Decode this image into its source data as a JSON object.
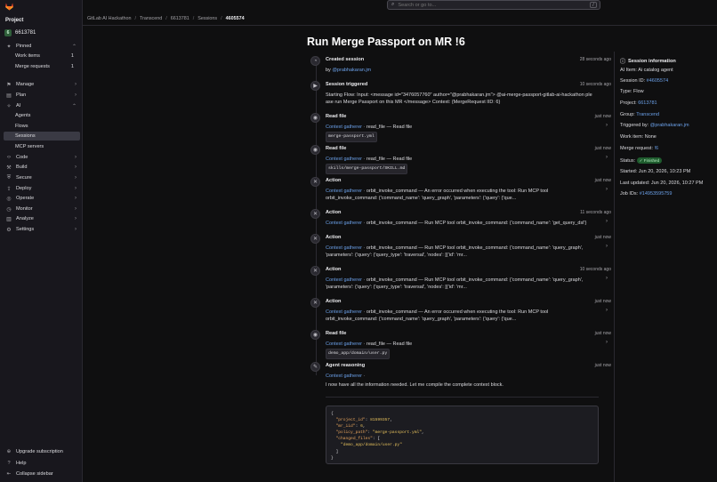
{
  "app": {
    "logo_icon": "gitlab-tanuki-icon"
  },
  "sidebar": {
    "context_label": "Project",
    "project": {
      "badge": "6",
      "name": "6613781"
    },
    "items": [
      {
        "label": "Pinned",
        "icon": "pin-icon",
        "chev": "⌃"
      },
      {
        "label": "Work items",
        "count": "1",
        "sub": true
      },
      {
        "label": "Merge requests",
        "count": "1",
        "sub": true
      },
      {
        "label": "Manage",
        "icon": "manage-icon",
        "chev": "›"
      },
      {
        "label": "Plan",
        "icon": "plan-icon",
        "chev": "›"
      },
      {
        "label": "AI",
        "icon": "ai-icon",
        "chev": "⌃"
      },
      {
        "label": "Agents",
        "sub": true
      },
      {
        "label": "Flows",
        "sub": true
      },
      {
        "label": "Sessions",
        "sub": true,
        "active": true
      },
      {
        "label": "MCP servers",
        "sub": true
      },
      {
        "label": "Code",
        "icon": "code-icon",
        "chev": "›"
      },
      {
        "label": "Build",
        "icon": "build-icon",
        "chev": "›"
      },
      {
        "label": "Secure",
        "icon": "shield-icon",
        "chev": "›"
      },
      {
        "label": "Deploy",
        "icon": "deploy-icon",
        "chev": "›"
      },
      {
        "label": "Operate",
        "icon": "operate-icon",
        "chev": "›"
      },
      {
        "label": "Monitor",
        "icon": "monitor-icon",
        "chev": "›"
      },
      {
        "label": "Analyze",
        "icon": "analyze-icon",
        "chev": "›"
      },
      {
        "label": "Settings",
        "icon": "gear-icon",
        "chev": "›"
      }
    ],
    "bottom": [
      {
        "label": "Upgrade subscription",
        "icon": "upgrade-icon"
      },
      {
        "label": "Help",
        "icon": "help-icon"
      },
      {
        "label": "Collapse sidebar",
        "icon": "collapse-icon"
      }
    ]
  },
  "search": {
    "placeholder": "Search or go to...",
    "shortcut": "/"
  },
  "breadcrumb": [
    "GitLab AI Hackathon",
    "Transcend",
    "6613781",
    "Sessions",
    "4605574"
  ],
  "page": {
    "title": "Run Merge Passport on MR !6"
  },
  "timeline": [
    {
      "title": "Created session",
      "time": "28 seconds ago",
      "icon": "session-icon",
      "line1_pre": "by ",
      "line1_link": "@prabhakaran.jm"
    },
    {
      "title": "Session triggered",
      "time": "10 seconds ago",
      "icon": "play-icon",
      "line1": "Starting Flow: Input: <message id=\"3476057760\" author=\"@prabhakaran.jm\"> @ai-merge-passport-gitlab-ai-hackathon ple",
      "line2": "ase run Merge Passport on this MR </message> Context: {MergeRequest IID: 6}"
    },
    {
      "title": "Read file",
      "time": "just now",
      "icon": "eye-icon",
      "agent": "Context gatherer",
      "action": "read_file — Read file",
      "code": "merge-passport.yml"
    },
    {
      "title": "Read file",
      "time": "just now",
      "icon": "eye-icon",
      "agent": "Context gatherer",
      "action": "read_file — Read file",
      "code": "skills/merge-passport/SKILL.md"
    },
    {
      "title": "Action",
      "time": "just now",
      "icon": "tool-icon",
      "agent": "Context gatherer",
      "action": "orbit_invoke_command — An error occurred when executing the tool: Run MCP tool",
      "line2": "orbit_invoke_command: {'command_name': 'query_graph', 'parameters': {'query': {'que..."
    },
    {
      "title": "Action",
      "time": "11 seconds ago",
      "icon": "tool-icon",
      "agent": "Context gatherer",
      "action": "orbit_invoke_command — Run MCP tool orbit_invoke_command: {'command_name': 'get_query_dsl'}"
    },
    {
      "title": "Action",
      "time": "just now",
      "icon": "tool-icon",
      "agent": "Context gatherer",
      "action": "orbit_invoke_command — Run MCP tool orbit_invoke_command: {'command_name': 'query_graph',",
      "line2": "'parameters': {'query': {'query_type': 'traversal', 'nodes': [{'id': 'mr..."
    },
    {
      "title": "Action",
      "time": "10 seconds ago",
      "icon": "tool-icon",
      "agent": "Context gatherer",
      "action": "orbit_invoke_command — Run MCP tool orbit_invoke_command: {'command_name': 'query_graph',",
      "line2": "'parameters': {'query': {'query_type': 'traversal', 'nodes': [{'id': 'mr..."
    },
    {
      "title": "Action",
      "time": "just now",
      "icon": "tool-icon",
      "agent": "Context gatherer",
      "action": "orbit_invoke_command — An error occurred when executing the tool: Run MCP tool",
      "line2": "orbit_invoke_command: {'command_name': 'query_graph', 'parameters': {'query': {'que..."
    },
    {
      "title": "Read file",
      "time": "just now",
      "icon": "eye-icon",
      "agent": "Context gatherer",
      "action": "read_file — Read file",
      "code": "demo_app/domain/user.py"
    },
    {
      "title": "Agent reasoning",
      "time": "just now",
      "icon": "reasoning-icon",
      "agent": "Context gatherer",
      "action": "",
      "line2": "I now have all the information needed. Let me compile the complete context block."
    }
  ],
  "codeblock": {
    "lines": [
      "{",
      "  \"project_id\": 81599357,",
      "  \"mr_iid\": 6,",
      "  \"policy_path\": \"merge-passport.yml\",",
      "  \"changed_files\": [",
      "    \"demo_app/domain/user.py\"",
      "  ]",
      "}"
    ]
  },
  "info": {
    "title": "Session information",
    "ai_item_label": "AI Item:",
    "ai_item_value": "Ai catalog agent",
    "session_id_label": "Session ID:",
    "session_id_value": "#4605574",
    "type_label": "Type:",
    "type_value": "Flow",
    "project_label": "Project:",
    "project_value": "6613781",
    "group_label": "Group:",
    "group_value": "Transcend",
    "triggered_label": "Triggered by:",
    "triggered_value": "@prabhakaran.jm",
    "work_item_label": "Work item:",
    "work_item_value": "None",
    "mr_label": "Merge request:",
    "mr_value": "!6",
    "status_label": "Status:",
    "status_value": "Finished",
    "started_label": "Started:",
    "started_value": "Jun 20, 2026, 10:23 PM",
    "updated_label": "Last updated:",
    "updated_value": "Jun 20, 2026, 10:27 PM",
    "job_label": "Job IDs:",
    "job_value": "#14953595759"
  }
}
